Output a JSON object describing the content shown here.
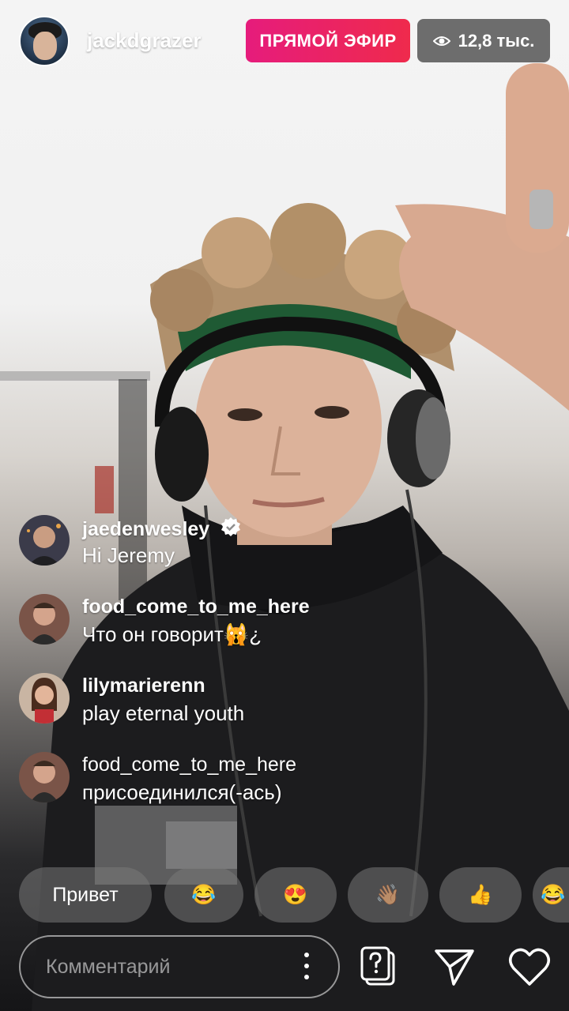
{
  "header": {
    "username": "jackdgrazer",
    "live_label": "ПРЯМОЙ ЭФИР",
    "viewer_count": "12,8 тыс."
  },
  "comments": [
    {
      "username": "jaedenwesley",
      "text": "Hi Jeremy",
      "verified": true,
      "type": "comment"
    },
    {
      "username": "food_come_to_me_here",
      "text": "Что он говорит🙀¿",
      "verified": false,
      "type": "comment"
    },
    {
      "username": "lilymarierenn",
      "text": "play eternal youth",
      "verified": false,
      "type": "comment"
    },
    {
      "username": "food_come_to_me_here",
      "text": "присоединился(-ась)",
      "verified": false,
      "type": "join"
    }
  ],
  "quick_reactions": [
    {
      "label": "Привет"
    },
    {
      "label": "😂"
    },
    {
      "label": "😍"
    },
    {
      "label": "👋🏽"
    },
    {
      "label": "👍"
    },
    {
      "label": "😂"
    }
  ],
  "composer": {
    "placeholder": "Комментарий"
  },
  "colors": {
    "live_gradient_start": "#e61c7c",
    "live_gradient_end": "#ef2a4c",
    "text": "#ffffff"
  },
  "icons": [
    "eye-icon",
    "verified-icon",
    "more-icon",
    "question-icon",
    "send-icon",
    "heart-icon"
  ]
}
